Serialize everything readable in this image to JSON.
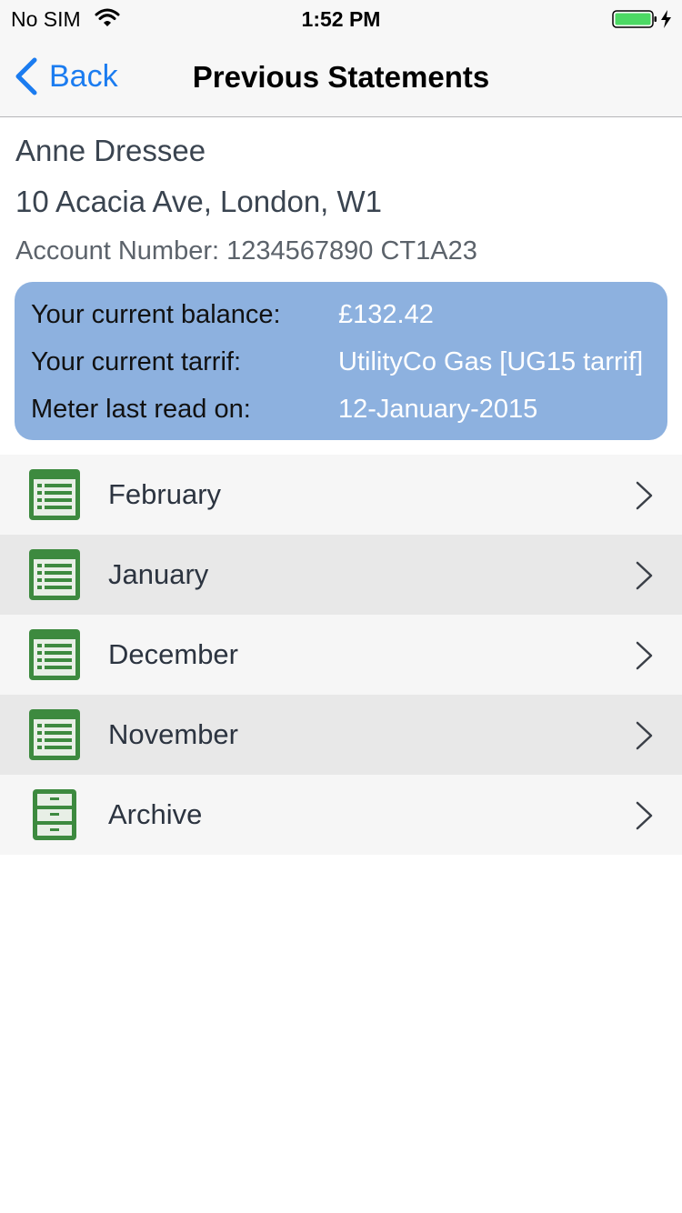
{
  "status_bar": {
    "carrier": "No SIM",
    "time": "1:52 PM"
  },
  "nav": {
    "back_label": "Back",
    "title": "Previous Statements"
  },
  "customer": {
    "name": "Anne Dressee",
    "address": "10 Acacia Ave, London, W1",
    "account": "Account Number: 1234567890 CT1A23"
  },
  "balance_card": {
    "rows": [
      {
        "label": "Your current balance:",
        "value": "£132.42"
      },
      {
        "label": "Your current tarrif:",
        "value": "UtilityCo Gas [UG15 tarrif]"
      },
      {
        "label": "Meter last read on:",
        "value": "12-January-2015"
      }
    ]
  },
  "statements": [
    {
      "label": "February",
      "icon": "statement-icon"
    },
    {
      "label": "January",
      "icon": "statement-icon"
    },
    {
      "label": "December",
      "icon": "statement-icon"
    },
    {
      "label": "November",
      "icon": "statement-icon"
    },
    {
      "label": "Archive",
      "icon": "filing-cabinet-icon"
    }
  ],
  "colors": {
    "accent": "#1b7cf0",
    "card": "#8db1df",
    "icon_green": "#3d8a3f",
    "battery_green": "#4cd964"
  }
}
